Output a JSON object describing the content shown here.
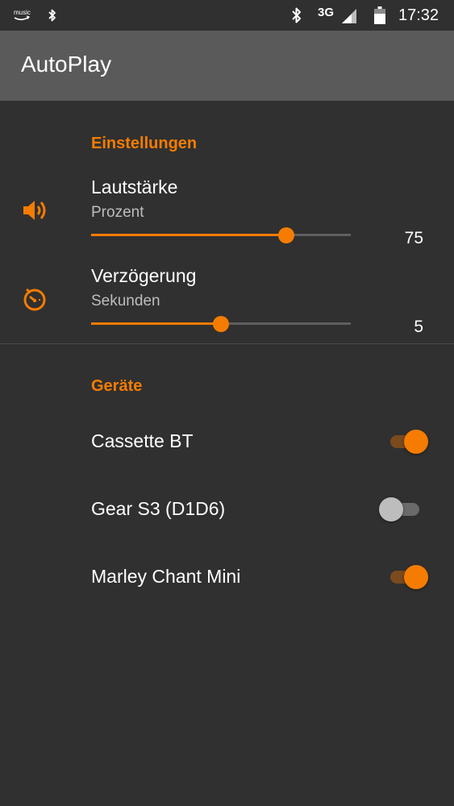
{
  "status_bar": {
    "music_label": "music",
    "network_type": "3G",
    "time": "17:32",
    "icons": [
      "music-icon",
      "bluetooth-icon",
      "bluetooth-icon",
      "signal-icon",
      "battery-icon"
    ]
  },
  "app_bar": {
    "title": "AutoPlay"
  },
  "settings_section": {
    "header": "Einstellungen",
    "volume": {
      "title": "Lautstärke",
      "summary": "Prozent",
      "value": "75",
      "min": 0,
      "max": 100,
      "icon": "volume-icon"
    },
    "delay": {
      "title": "Verzögerung",
      "summary": "Sekunden",
      "value": "5",
      "min": 0,
      "max": 10,
      "icon": "timer-icon"
    }
  },
  "devices_section": {
    "header": "Geräte",
    "devices": [
      {
        "name": "Cassette BT",
        "enabled": true
      },
      {
        "name": "Gear S3 (D1D6)",
        "enabled": false
      },
      {
        "name": "Marley Chant Mini",
        "enabled": true
      }
    ]
  },
  "colors": {
    "accent": "#f57c00",
    "background": "#303030",
    "app_bar": "#5a5a5a"
  }
}
